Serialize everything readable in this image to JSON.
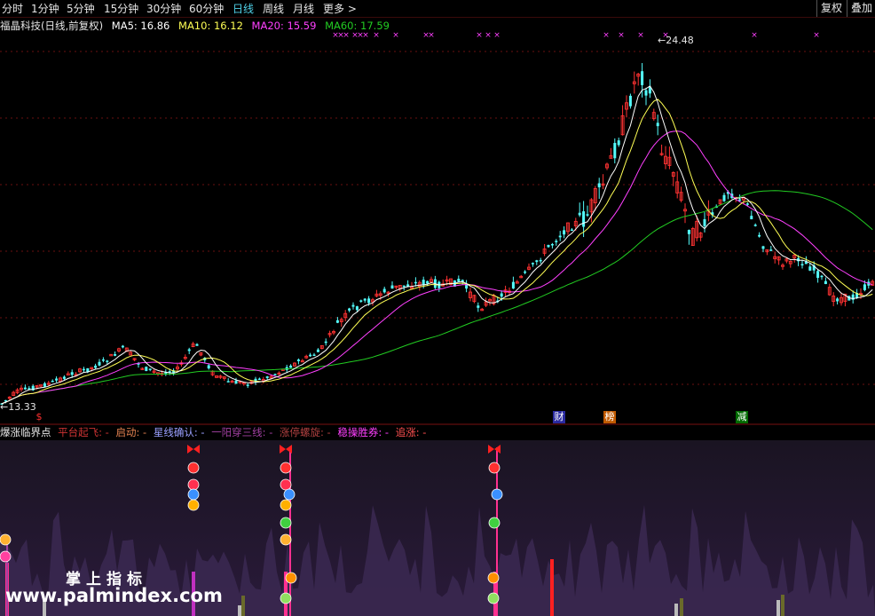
{
  "toolbar": {
    "tabs": [
      "分时",
      "1分钟",
      "5分钟",
      "15分钟",
      "30分钟",
      "60分钟",
      "日线",
      "周线",
      "月线",
      "更多 >"
    ],
    "active_tab": "日线",
    "fuquan_label": "复权",
    "diejia_label": "叠加"
  },
  "ma_line": {
    "stock": "福晶科技(日线,前复权)",
    "ma5": "MA5: 16.86",
    "ma10": "MA10: 16.12",
    "ma20": "MA20: 15.59",
    "ma60": "MA60: 17.59"
  },
  "price": {
    "high_label": "24.48",
    "low_label": "13.33"
  },
  "tags": {
    "dollar": "$",
    "cai": "财",
    "bang": "榜",
    "jian": "减"
  },
  "indicator": {
    "title": "爆涨临界点",
    "items": [
      "平台起飞: -",
      "启动: -",
      "星线确认: -",
      "一阳穿三线: -",
      "涨停螺旋: -",
      "稳操胜券: -",
      "追涨: -"
    ]
  },
  "watermark": {
    "line1": "掌上指标",
    "line2": "www.palmindex.com"
  },
  "colors": {
    "up": "#ff3232",
    "down": "#54fcfc",
    "ma5": "#ffffff",
    "ma10": "#ffff55",
    "ma20": "#ff40ff",
    "ma60": "#22cc22",
    "active_tab": "#4fd1e8"
  }
}
